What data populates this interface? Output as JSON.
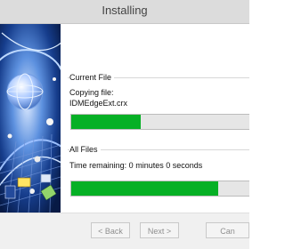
{
  "window": {
    "title": "Installing"
  },
  "current_file": {
    "label": "Current File",
    "status": "Copying file:",
    "filename": "IDMEdgeExt.crx",
    "progress_percent": 37
  },
  "all_files": {
    "label": "All Files",
    "time_remaining": "Time remaining: 0 minutes 0 seconds",
    "progress_percent": 78
  },
  "buttons": {
    "back": "< Back",
    "next": "Next >",
    "cancel": "Can"
  },
  "colors": {
    "progress_fill": "#06b025",
    "banner_background": "#0c2a68"
  }
}
